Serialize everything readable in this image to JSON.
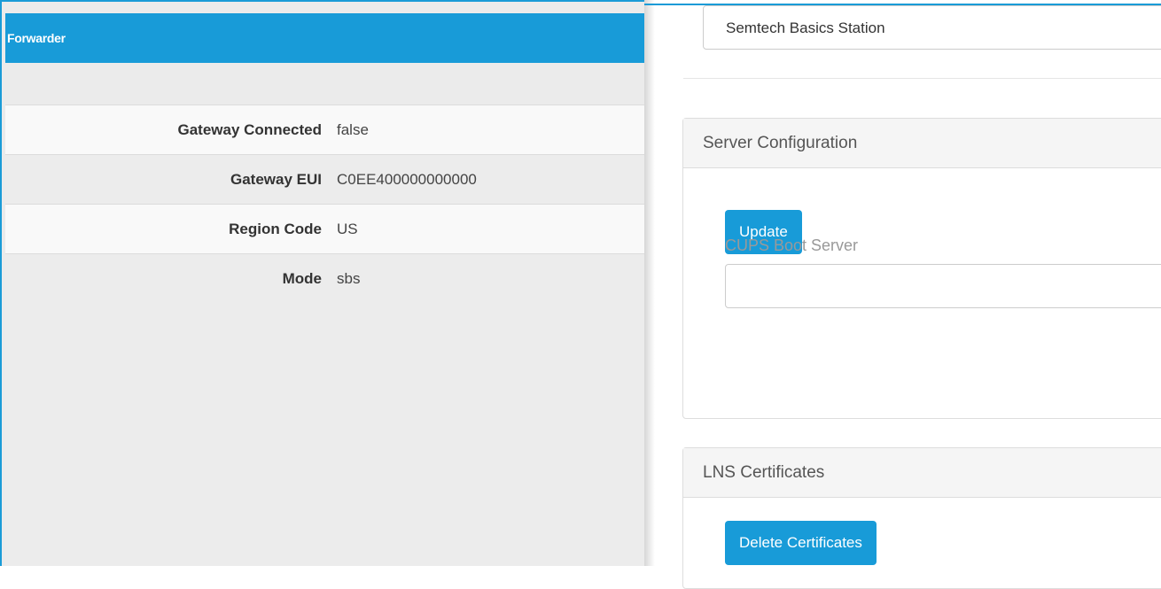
{
  "forwarder": {
    "title": "Forwarder",
    "rows": [
      {
        "label": "Gateway Connected",
        "value": "false"
      },
      {
        "label": "Gateway EUI",
        "value": "C0EE400000000000"
      },
      {
        "label": "Region Code",
        "value": "US"
      },
      {
        "label": "Mode",
        "value": "sbs"
      }
    ]
  },
  "mode_select": {
    "selected": "Semtech Basics Station"
  },
  "server_config": {
    "title": "Server Configuration",
    "update_label": "Update",
    "cups_label": "CUPS Boot Server",
    "cups_value": ""
  },
  "lns_certificates": {
    "title": "LNS Certificates",
    "delete_label": "Delete Certificates"
  },
  "colors": {
    "accent": "#189bd8"
  }
}
